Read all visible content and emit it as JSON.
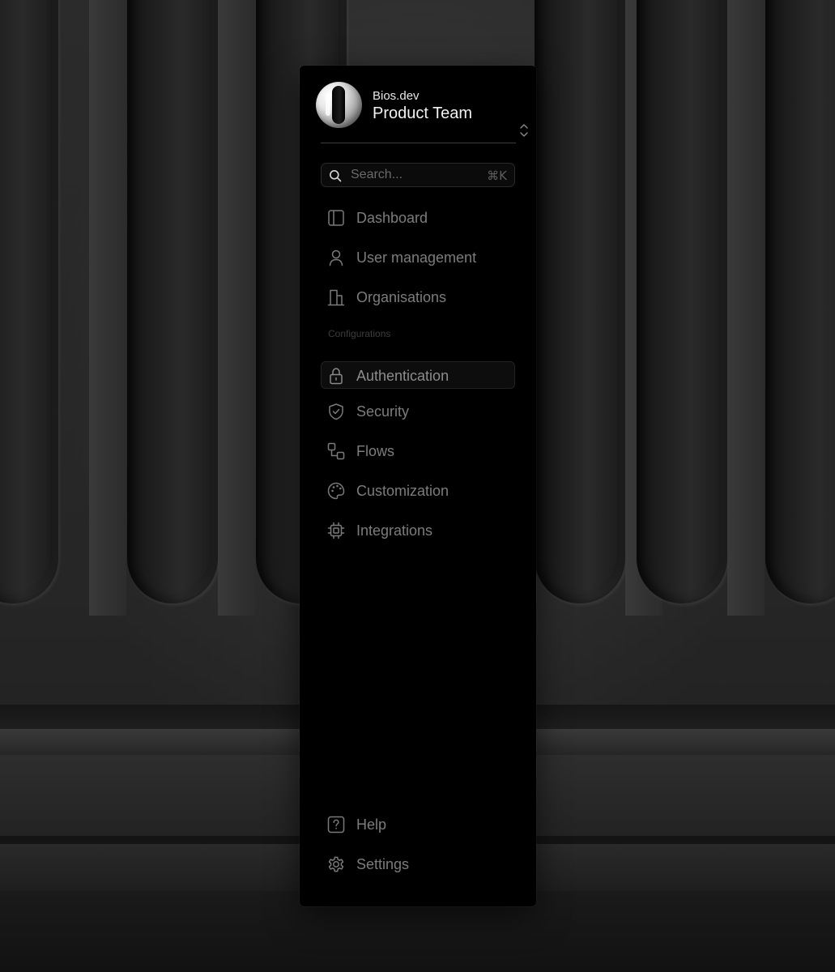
{
  "workspace": {
    "org_name": "Bios.dev",
    "team_name": "Product Team"
  },
  "search": {
    "placeholder": "Search...",
    "shortcut": "⌘K"
  },
  "nav": {
    "main": [
      {
        "label": "Dashboard",
        "icon": "sidebar-panel-icon"
      },
      {
        "label": "User management",
        "icon": "user-icon"
      },
      {
        "label": "Organisations",
        "icon": "building-icon"
      }
    ],
    "section_label": "Configurations",
    "config": [
      {
        "label": "Authentication",
        "icon": "lock-icon",
        "active": true
      },
      {
        "label": "Security",
        "icon": "shield-check-icon"
      },
      {
        "label": "Flows",
        "icon": "flow-icon"
      },
      {
        "label": "Customization",
        "icon": "palette-icon"
      },
      {
        "label": "Integrations",
        "icon": "chip-icon"
      }
    ],
    "footer": [
      {
        "label": "Help",
        "icon": "help-icon"
      },
      {
        "label": "Settings",
        "icon": "gear-icon"
      }
    ]
  },
  "colors": {
    "sidebar_bg": "#000000",
    "text_primary": "#f2f2f2",
    "text_muted": "#7c7c7c",
    "section_label": "#3d3d3d",
    "divider": "#3c3c3c"
  }
}
